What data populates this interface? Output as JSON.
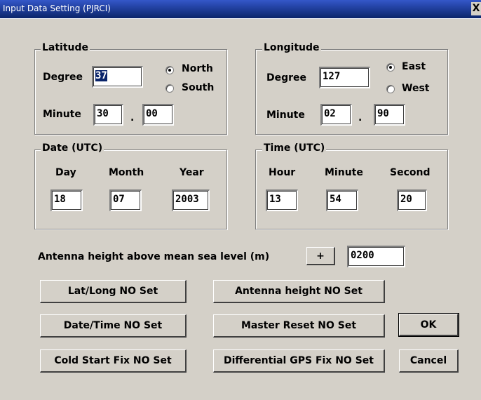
{
  "window": {
    "title": "Input Data Setting (PJRCI)",
    "close_label": "X"
  },
  "latitude": {
    "legend": "Latitude",
    "degree_label": "Degree",
    "degree_value": "37",
    "north_label": "North",
    "south_label": "South",
    "selected": "North",
    "minute_label": "Minute",
    "minute_value": "30",
    "separator": ".",
    "minute_fraction": "00"
  },
  "longitude": {
    "legend": "Longitude",
    "degree_label": "Degree",
    "degree_value": "127",
    "east_label": "East",
    "west_label": "West",
    "selected": "East",
    "minute_label": "Minute",
    "minute_value": "02",
    "separator": ".",
    "minute_fraction": "90"
  },
  "date": {
    "legend": "Date (UTC)",
    "day_label": "Day",
    "month_label": "Month",
    "year_label": "Year",
    "day_value": "18",
    "month_value": "07",
    "year_value": "2003"
  },
  "time": {
    "legend": "Time (UTC)",
    "hour_label": "Hour",
    "minute_label": "Minute",
    "second_label": "Second",
    "hour_value": "13",
    "minute_value": "54",
    "second_value": "20"
  },
  "antenna": {
    "label": "Antenna height above mean sea level (m)",
    "sign_button": "+",
    "value": "0200"
  },
  "buttons": {
    "latlong_set": "Lat/Long NO Set",
    "antenna_set": "Antenna height NO Set",
    "datetime_set": "Date/Time NO Set",
    "master_reset": "Master Reset NO Set",
    "ok": "OK",
    "cold_start": "Cold Start Fix NO Set",
    "diff_gps": "Differential GPS Fix NO Set",
    "cancel": "Cancel"
  }
}
